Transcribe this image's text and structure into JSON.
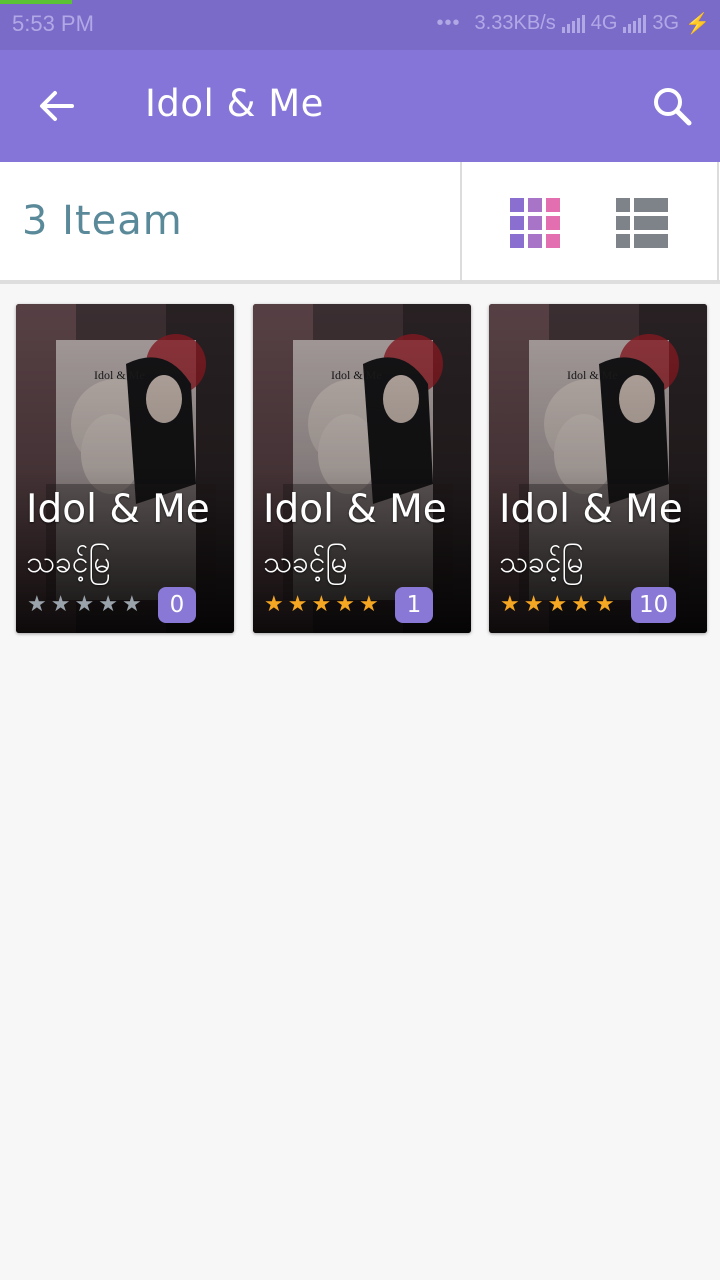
{
  "status_bar": {
    "time": "5:53 PM",
    "dots": "•••",
    "speed": "3.33KB/s",
    "network1": "4G",
    "network2": "3G",
    "colors": {
      "background": "#7b6bc9",
      "text": "#b1a8e6",
      "progress": "#5bc236"
    }
  },
  "app_bar": {
    "title": "Idol & Me",
    "back_icon": "arrow-left-icon",
    "search_icon": "search-icon",
    "color": "#8575d8"
  },
  "toolbar": {
    "item_count": "3 Iteam",
    "grid_icon": "grid-view-icon",
    "list_icon": "list-view-icon",
    "grid_colors": [
      "#8a6fd0",
      "#a874c8",
      "#e46fb0"
    ]
  },
  "books": [
    {
      "title": "Idol & Me",
      "author": "သခင့်မြ",
      "cover_caption": "Idol & Me",
      "rating": 0,
      "count": "0"
    },
    {
      "title": "Idol & Me",
      "author": "သခင့်မြ",
      "cover_caption": "Idol & Me",
      "rating": 5,
      "count": "1"
    },
    {
      "title": "Idol & Me",
      "author": "သခင့်မြ",
      "cover_caption": "Idol & Me",
      "rating": 5,
      "count": "10"
    }
  ],
  "star_colors": {
    "on": "#f5a623",
    "off": "#9aa3ab"
  }
}
